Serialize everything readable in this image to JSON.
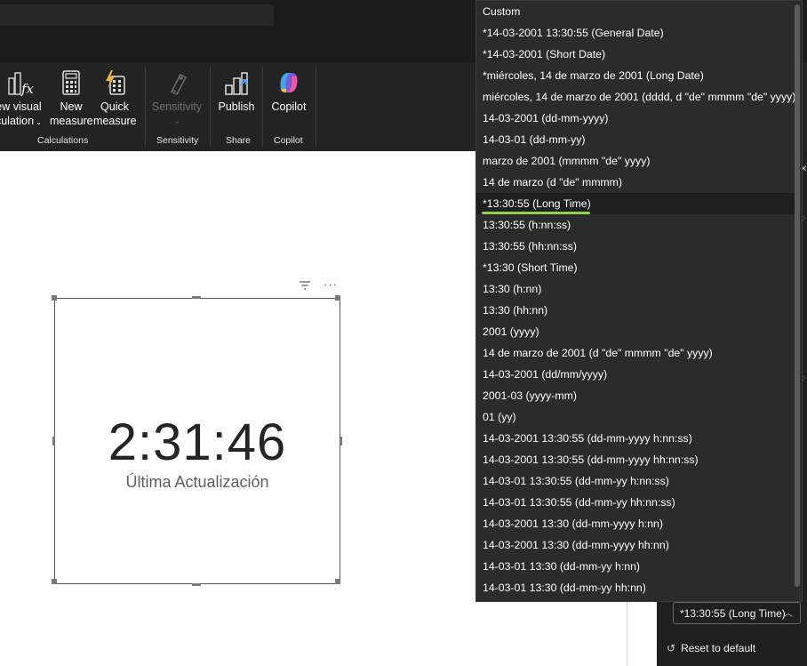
{
  "ribbon": {
    "visual_calc": "ew visual",
    "visual_calc_line2": "culation",
    "new_measure": "New",
    "new_measure_line2": "measure",
    "quick_measure": "Quick",
    "quick_measure_line2": "measure",
    "sensitivity_btn": "Sensitivity",
    "publish": "Publish",
    "copilot": "Copilot",
    "groups": {
      "calculations": "Calculations",
      "sensitivity": "Sensitivity",
      "share": "Share",
      "copilot": "Copilot"
    }
  },
  "card": {
    "value": "2:31:46",
    "label": "Última Actualización"
  },
  "format_panel": {
    "selected_format": "*13:30:55 (Long Time)",
    "reset": "Reset to default"
  },
  "dropdown": {
    "options": [
      "Custom",
      "*14-03-2001 13:30:55 (General Date)",
      "*14-03-2001 (Short Date)",
      "*miércoles, 14 de marzo de 2001 (Long Date)",
      "miércoles, 14 de marzo de 2001 (dddd, d \"de\" mmmm \"de\" yyyy)",
      "14-03-2001 (dd-mm-yyyy)",
      "14-03-01 (dd-mm-yy)",
      "marzo de 2001 (mmmm \"de\" yyyy)",
      "14 de marzo (d \"de\" mmmm)",
      "*13:30:55 (Long Time)",
      "13:30:55 (h:nn:ss)",
      "13:30:55 (hh:nn:ss)",
      "*13:30 (Short Time)",
      "13:30 (h:nn)",
      "13:30 (hh:nn)",
      "2001 (yyyy)",
      "14 de marzo de 2001 (d \"de\" mmmm \"de\" yyyy)",
      "14-03-2001 (dd/mm/yyyy)",
      "2001-03 (yyyy-mm)",
      "01 (yy)",
      "14-03-2001 13:30:55 (dd-mm-yyyy h:nn:ss)",
      "14-03-2001 13:30:55 (dd-mm-yyyy hh:nn:ss)",
      "14-03-01 13:30:55 (dd-mm-yy h:nn:ss)",
      "14-03-01 13:30:55 (dd-mm-yy hh:nn:ss)",
      "14-03-2001 13:30 (dd-mm-yyyy h:nn)",
      "14-03-2001 13:30 (dd-mm-yyyy hh:nn)",
      "14-03-01 13:30 (dd-mm-yy h:nn)",
      "14-03-01 13:30 (dd-mm-yy hh:nn)"
    ],
    "selected_index": 9
  },
  "colors": {
    "highlight_underline": "#92d050",
    "dropdown_bg": "#2b2b2b",
    "ribbon_bg": "#232323"
  },
  "icons": {
    "visual_calc": "fx-calculator-icon",
    "new_measure": "calculator-icon",
    "quick_measure": "lightning-calculator-icon",
    "sensitivity": "sensitivity-label-icon",
    "publish": "publish-icon",
    "copilot": "copilot-icon",
    "filter": "filter-icon",
    "more": "more-options-icon",
    "reset": "reset-icon"
  }
}
